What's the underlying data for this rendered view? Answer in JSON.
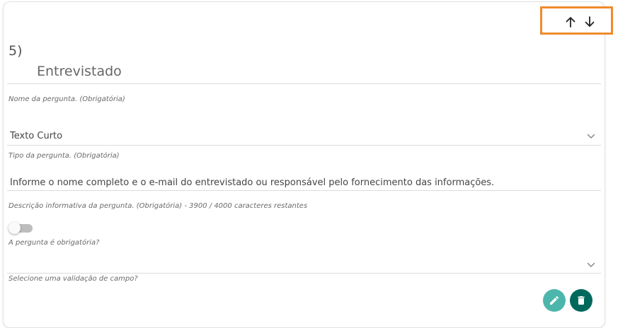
{
  "question": {
    "number": "5)",
    "title": "Entrevistado",
    "name_hint": "Nome da pergunta. (Obrigatória)",
    "type_value": "Texto Curto",
    "type_hint": "Tipo da pergunta. (Obrigatória)",
    "description_value": "Informe o nome completo e o e-mail do entrevistado ou responsável pelo fornecimento das informações.",
    "description_hint": "Descrição informativa da pergunta. (Obrigatória) - 3900 / 4000 caracteres restantes",
    "required_hint": "A pergunta é obrigatória?",
    "validation_hint": "Selecione uma validação de campo?"
  },
  "toggle": {
    "required_on": false
  },
  "icons": {
    "move_up": "arrow-up-icon",
    "move_down": "arrow-down-icon",
    "type_dropdown": "chevron-down-icon",
    "validation_dropdown": "chevron-down-icon",
    "edit": "pencil-icon",
    "delete": "trash-icon"
  },
  "colors": {
    "highlight": "#f08a2c",
    "edit_button": "#4db6ac",
    "delete_button": "#00695c",
    "toggle_track": "#bdbdbd"
  }
}
